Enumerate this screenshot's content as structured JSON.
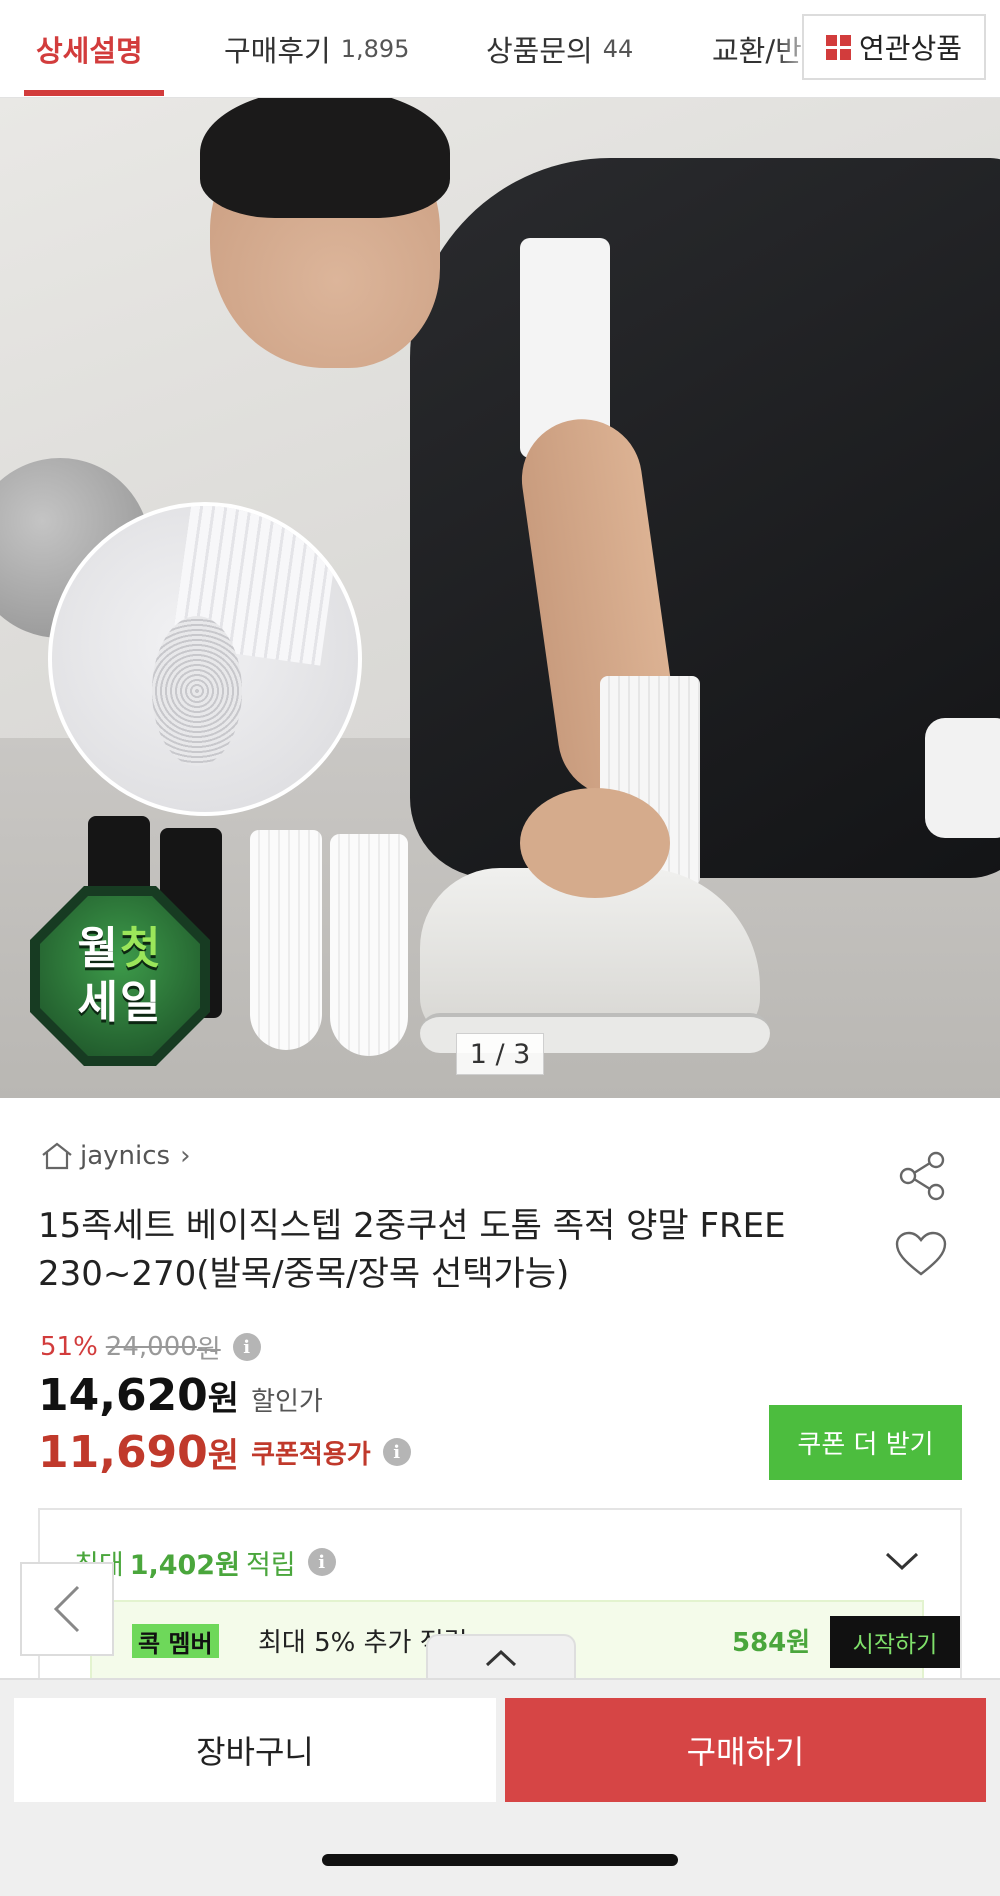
{
  "tabs": [
    {
      "label": "상세설명",
      "count": "",
      "active": true
    },
    {
      "label": "구매후기",
      "count": "1,895",
      "active": false
    },
    {
      "label": "상품문의",
      "count": "44",
      "active": false
    },
    {
      "label": "교환/반",
      "count": "",
      "active": false
    }
  ],
  "related_button": {
    "label": "연관상품",
    "icon": "grid-icon"
  },
  "hero": {
    "badge_line1_a": "월",
    "badge_line1_b": "첫",
    "badge_line2": "세일",
    "counter": "1 / 3"
  },
  "store": {
    "name": "jaynics",
    "icon": "home-icon",
    "chevron": "›"
  },
  "product": {
    "title": "15족세트 베이직스텝 2중쿠션 도톰 족적 양말 FREE 230~270(발목/중목/장목 선택가능)"
  },
  "price": {
    "discount_rate": "51%",
    "original": "24,000",
    "original_unit": "원",
    "sale": "14,620",
    "sale_unit": "원",
    "sale_label": "할인가",
    "coupon_price": "11,690",
    "coupon_unit": "원",
    "coupon_label": "쿠폰적용가",
    "coupon_button": "쿠폰 더 받기"
  },
  "points": {
    "prefix": "최대",
    "amount": "1,402원",
    "suffix": "적립",
    "member_badge": "콕 멤버",
    "member_text": "최대 5% 추가 적립",
    "member_amount": "584원",
    "start_button": "시작하기"
  },
  "bottom": {
    "cart_button": "장바구니",
    "buy_button": "구매하기"
  },
  "colors": {
    "accent_red": "#d23c3c",
    "buy_red": "#d64545",
    "coupon_green": "#4cbd3e",
    "points_green": "#4aa63c"
  }
}
